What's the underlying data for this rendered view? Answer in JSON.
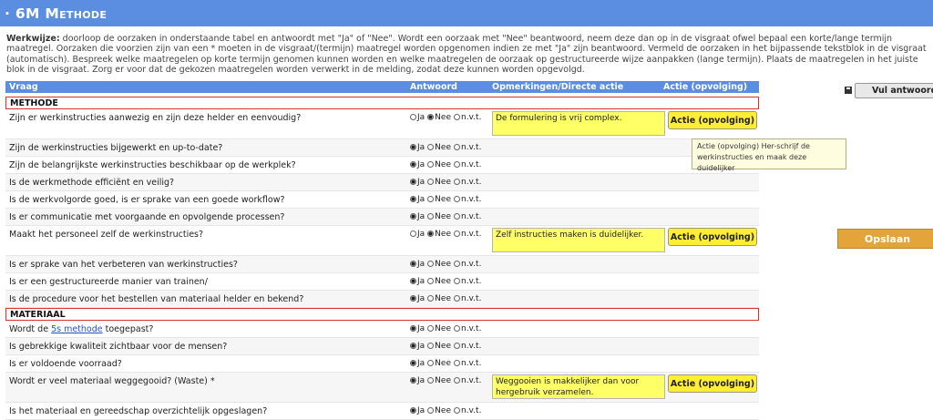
{
  "banner": {
    "title": "· 6M Methode"
  },
  "intro": {
    "label": "Werkwijze:",
    "text": " doorloop de oorzaken in onderstaande tabel en antwoordt met \"Ja\" of \"Nee\". Wordt een oorzaak met \"Nee\" beantwoord, neem deze dan op in de visgraat ofwel bepaal een korte/lange termijn maatregel. Oorzaken die voorzien zijn van een * moeten in de visgraat/(termijn) maatregel worden opgenomen indien ze met \"Ja\" zijn beantwoord. Vermeld de oorzaken in het bijpassende tekstblok in de visgraat (automatisch). Bespreek welke maatregelen op korte termijn genomen kunnen worden en welke maatregelen de oorzaak op gestructureerde wijze aanpakken (lange termijn). Plaats de maatregelen in het juiste blok in de visgraat. Zorg er voor dat de gekozen maatregelen worden verwerkt in de melding, zodat deze kunnen worden opgevolgd."
  },
  "header": {
    "vraag": "Vraag",
    "antwoord": "Antwoord",
    "opmerkingen": "Opmerkingen/Directe actie",
    "actie": "Actie (opvolging)"
  },
  "options": {
    "ja": "Ja",
    "nee": "Nee",
    "nvt": "n.v.t."
  },
  "sections": {
    "methode": "METHODE",
    "materiaal": "MATERIAAL"
  },
  "methode_rows": [
    {
      "q": "Zijn er werkinstructies aanwezig en zijn deze helder en eenvoudig?",
      "answer": "nee",
      "remark": "De formulering is vrij complex.",
      "action": "Actie (opvolging)"
    },
    {
      "q": "Zijn de werkinstructies bijgewerkt en up-to-date?",
      "answer": "ja"
    },
    {
      "q": "Zijn de belangrijkste werkinstructies beschikbaar op de werkplek?",
      "answer": "ja"
    },
    {
      "q": "Is de werkmethode efficiënt en veilig?",
      "answer": "ja"
    },
    {
      "q": "Is de werkvolgorde goed, is er sprake van een goede workflow?",
      "answer": "ja"
    },
    {
      "q": "Is er communicatie met voorgaande en opvolgende processen?",
      "answer": "ja"
    },
    {
      "q": "Maakt het personeel zelf de werkinstructies?",
      "answer": "nee",
      "remark": "Zelf instructies maken is duidelijker.",
      "action": "Actie (opvolging)"
    },
    {
      "q": "Is er sprake van het verbeteren van werkinstructies?",
      "answer": "ja"
    },
    {
      "q": "Is er een gestructureerde manier van trainen/",
      "answer": "ja"
    },
    {
      "q": "Is de procedure voor het bestellen van materiaal helder en bekend?",
      "answer": "ja"
    }
  ],
  "materiaal_rows": [
    {
      "q_prefix": "Wordt de ",
      "q_link": "5s methode",
      "q_suffix": " toegepast?",
      "answer": "ja"
    },
    {
      "q": "Is gebrekkige kwaliteit zichtbaar voor de mensen?",
      "answer": "ja"
    },
    {
      "q": "Is er voldoende voorraad?",
      "answer": "ja"
    },
    {
      "q": "Wordt er veel materiaal weggegooid? (Waste) *",
      "answer": "ja",
      "remark": "Weggooien is makkelijker dan voor hergebruik verzamelen.",
      "action": "Actie (opvolging)"
    },
    {
      "q": "Is het materiaal en gereedschap overzichtelijk opgeslagen?",
      "answer": "ja"
    }
  ],
  "tooltip": "Actie (opvolging) Her-schrijf de werkinstructies en maak deze duidelijker",
  "fill_button": "Vul antwoorden",
  "save_button": "Opslaan"
}
